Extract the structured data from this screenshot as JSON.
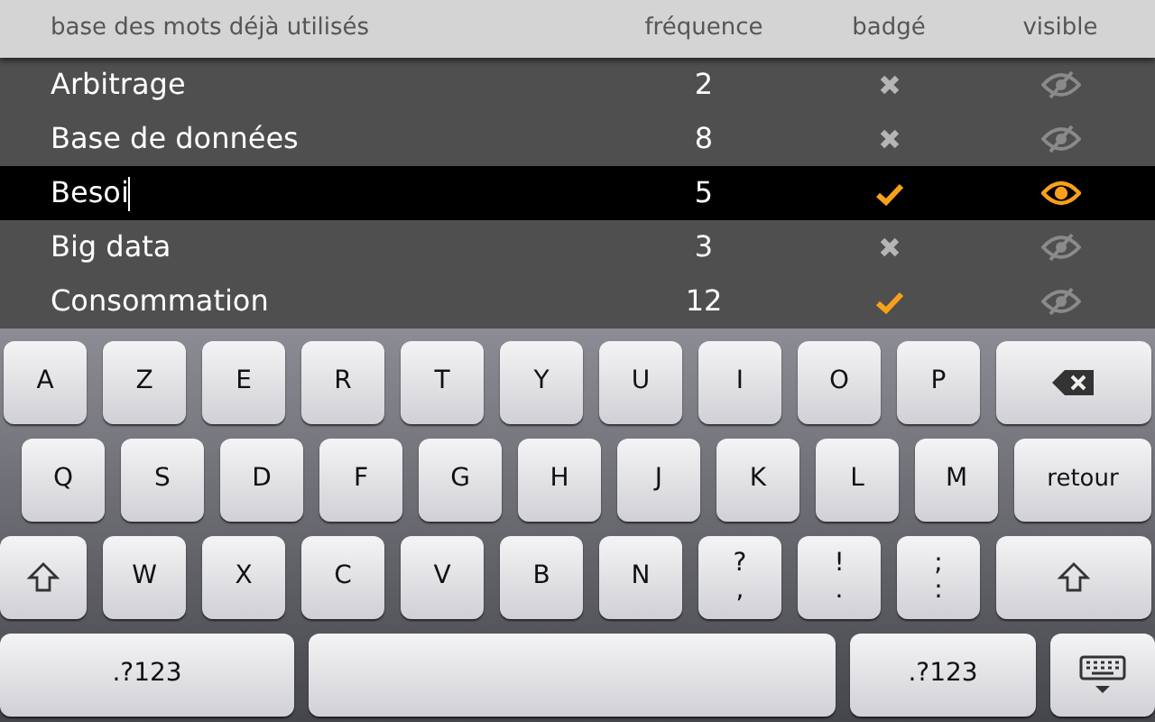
{
  "header": {
    "columns": [
      "base des mots déjà utilisés",
      "fréquence",
      "badgé",
      "visible"
    ]
  },
  "words": [
    {
      "word": "Arbitrage",
      "frequency": "2",
      "badged": false,
      "visible": false,
      "selected": false
    },
    {
      "word": "Base de données",
      "frequency": "8",
      "badged": false,
      "visible": false,
      "selected": false
    },
    {
      "word": "Besoi",
      "frequency": "5",
      "badged": true,
      "visible": true,
      "selected": true
    },
    {
      "word": "Big data",
      "frequency": "3",
      "badged": false,
      "visible": false,
      "selected": false
    },
    {
      "word": "Consommation",
      "frequency": "12",
      "badged": true,
      "visible": false,
      "selected": false
    }
  ],
  "keyboard": {
    "rows": [
      {
        "keys": [
          {
            "kind": "letter",
            "label": "A"
          },
          {
            "kind": "letter",
            "label": "Z"
          },
          {
            "kind": "letter",
            "label": "E"
          },
          {
            "kind": "letter",
            "label": "R"
          },
          {
            "kind": "letter",
            "label": "T"
          },
          {
            "kind": "letter",
            "label": "Y"
          },
          {
            "kind": "letter",
            "label": "U"
          },
          {
            "kind": "letter",
            "label": "I"
          },
          {
            "kind": "letter",
            "label": "O"
          },
          {
            "kind": "letter",
            "label": "P"
          },
          {
            "kind": "backspace"
          }
        ]
      },
      {
        "keys": [
          {
            "kind": "letter",
            "label": "Q"
          },
          {
            "kind": "letter",
            "label": "S"
          },
          {
            "kind": "letter",
            "label": "D"
          },
          {
            "kind": "letter",
            "label": "F"
          },
          {
            "kind": "letter",
            "label": "G"
          },
          {
            "kind": "letter",
            "label": "H"
          },
          {
            "kind": "letter",
            "label": "J"
          },
          {
            "kind": "letter",
            "label": "K"
          },
          {
            "kind": "letter",
            "label": "L"
          },
          {
            "kind": "letter",
            "label": "M"
          },
          {
            "kind": "return",
            "label": "retour"
          }
        ]
      },
      {
        "keys": [
          {
            "kind": "shift"
          },
          {
            "kind": "letter",
            "label": "W"
          },
          {
            "kind": "letter",
            "label": "X"
          },
          {
            "kind": "letter",
            "label": "C"
          },
          {
            "kind": "letter",
            "label": "V"
          },
          {
            "kind": "letter",
            "label": "B"
          },
          {
            "kind": "letter",
            "label": "N"
          },
          {
            "kind": "dual",
            "top": "?",
            "bottom": ","
          },
          {
            "kind": "dual",
            "top": "!",
            "bottom": "."
          },
          {
            "kind": "dual",
            "top": ";",
            "bottom": ":"
          },
          {
            "kind": "shift"
          }
        ]
      },
      {
        "keys": [
          {
            "kind": "mode",
            "label": ".?123"
          },
          {
            "kind": "space"
          },
          {
            "kind": "mode",
            "label": ".?123"
          },
          {
            "kind": "hide"
          }
        ]
      }
    ]
  }
}
